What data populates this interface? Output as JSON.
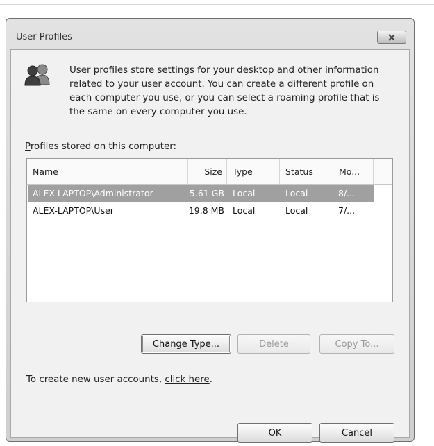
{
  "window": {
    "title": "User Profiles",
    "close_icon": "close-icon"
  },
  "intro": {
    "icon": "users-icon",
    "text": "User profiles store settings for your desktop and other information related to your user account. You can create a different profile on each computer you use, or you can select a roaming profile that is the same on every computer you use."
  },
  "profiles": {
    "label_prefix": "P",
    "label_rest": "rofiles stored on this computer:",
    "columns": [
      "Name",
      "Size",
      "Type",
      "Status",
      "Mo..."
    ],
    "rows": [
      {
        "name": "ALEX-LAPTOP\\Administrator",
        "size": "5.61 GB",
        "type": "Local",
        "status": "Local",
        "modified": "8/...",
        "selected": true
      },
      {
        "name": "ALEX-LAPTOP\\User",
        "size": "19.8 MB",
        "type": "Local",
        "status": "Local",
        "modified": "7/...",
        "selected": false
      }
    ]
  },
  "buttons": {
    "change_type": "Change Type...",
    "delete": "Delete",
    "copy_to": "Copy To...",
    "ok": "OK",
    "cancel": "Cancel"
  },
  "create": {
    "text": "To create new user accounts, ",
    "link": "click here",
    "suffix": "."
  },
  "colors": {
    "selection": "#a0a0a0",
    "dialog_bg": "#f1f1f1"
  }
}
